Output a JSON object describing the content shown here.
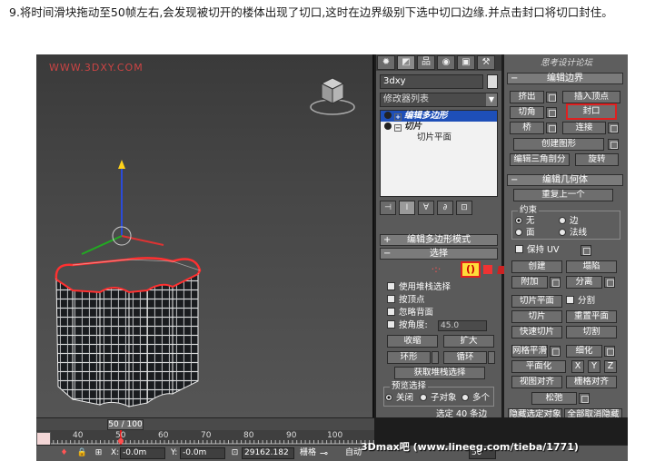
{
  "caption": "9.将时间滑块拖动至50帧左右,会发现被切开的楼体出现了切口,这时在边界级别下选中切口边缘.并点击封口将切口封住。",
  "viewport": {
    "watermark": "WWW.3DXY.COM"
  },
  "command_panel": {
    "tabs": [
      "✹",
      "◩",
      "品",
      "◉",
      "▣",
      "⚒"
    ],
    "object_name": "3dxy",
    "modifier_list": "修改器列表",
    "stack": [
      {
        "label": "编辑多边形",
        "selected": true
      },
      {
        "label": "切片",
        "selected": false
      },
      {
        "label": "切片平面",
        "selected": false
      }
    ],
    "stack_tools": [
      "⊣",
      "I",
      "∀",
      "∂",
      "⊡"
    ],
    "rollout_edit_poly": "编辑多边形模式",
    "rollout_selection": "选择",
    "selection_options": {
      "use_stack": "使用堆栈选择",
      "by_vertex": "按顶点",
      "ignore_backface": "忽略背面",
      "by_angle": "按角度:",
      "angle_value": "45.0"
    },
    "selection_buttons": {
      "shrink": "收缩",
      "grow": "扩大",
      "ring": "环形",
      "loop": "循环",
      "get_stack": "获取堆栈选择"
    },
    "preview_selection": {
      "title": "预览选择",
      "off": "关闭",
      "subobject": "子对象",
      "multi": "多个"
    },
    "selected_count": "选定 40 条边"
  },
  "sub_panel": {
    "title": "思考设计论坛",
    "edit_borders": {
      "header": "编辑边界",
      "extrude": "挤出",
      "insert_vertex": "插入顶点",
      "chamfer": "切角",
      "cap": "封口",
      "bridge": "桥",
      "connect": "连接",
      "create_shape": "创建图形",
      "edit_tri": "编辑三角剖分",
      "turn": "旋转"
    },
    "edit_geometry": {
      "header": "编辑几何体",
      "repeat_last": "重复上一个",
      "constraints": "约束",
      "none": "无",
      "edge": "边",
      "face": "面",
      "normal": "法线",
      "preserve_uv": "保持 UV",
      "create": "创建",
      "collapse": "塌陷",
      "attach": "附加",
      "detach": "分离",
      "slice_plane": "切片平面",
      "split": "分割",
      "slice": "切片",
      "reset_plane": "重置平面",
      "quickslice": "快速切片",
      "cut": "切割",
      "msmooth": "网格平滑",
      "tessellate": "细化",
      "make_planar": "平面化",
      "x": "X",
      "y": "Y",
      "z": "Z",
      "view_align": "视图对齐",
      "grid_align": "栅格对齐",
      "relax": "松弛",
      "hide_selected": "隐藏选定对象",
      "unhide_all": "全部取消隐藏"
    }
  },
  "timeline": {
    "thumb": "50 / 100",
    "ticks": [
      "40",
      "50",
      "60",
      "70",
      "80",
      "90",
      "100"
    ]
  },
  "status_bar": {
    "x_label": "X:",
    "x_value": "-0.0m",
    "y_label": "Y:",
    "y_value": "-0.0m",
    "z_label": "Z:",
    "z_value": "29162.182",
    "grid": "栅格",
    "auto_key": "自动",
    "frame": "50",
    "watermark": "3Dmax吧 (www.lineeg.com/tieba/1771)"
  }
}
